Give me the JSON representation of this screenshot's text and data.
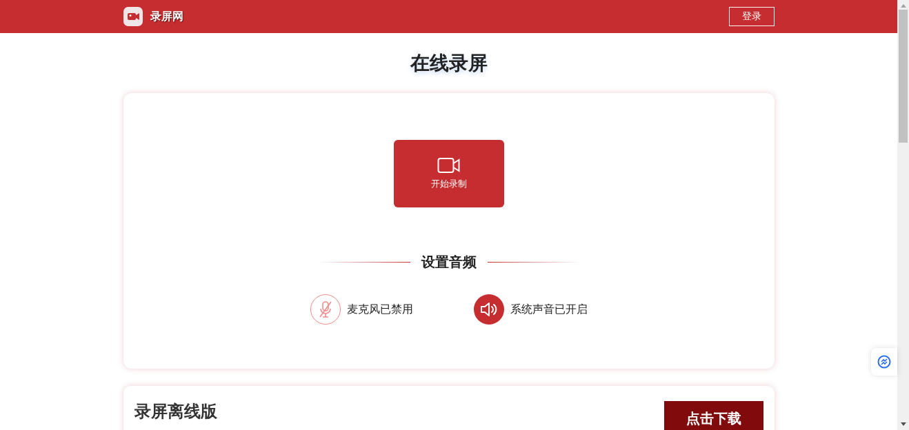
{
  "header": {
    "site_name": "录屏网",
    "login_button": "登录"
  },
  "page_title": "在线录屏",
  "recorder": {
    "start_button": "开始录制",
    "audio_heading": "设置音频",
    "audio_toggles": [
      {
        "kind": "microphone",
        "label": "麦克风已禁用",
        "on": false
      },
      {
        "kind": "speaker",
        "label": "系统声音已开启",
        "on": true
      }
    ]
  },
  "offline": {
    "title": "录屏离线版",
    "download_button": "点击下载"
  }
}
